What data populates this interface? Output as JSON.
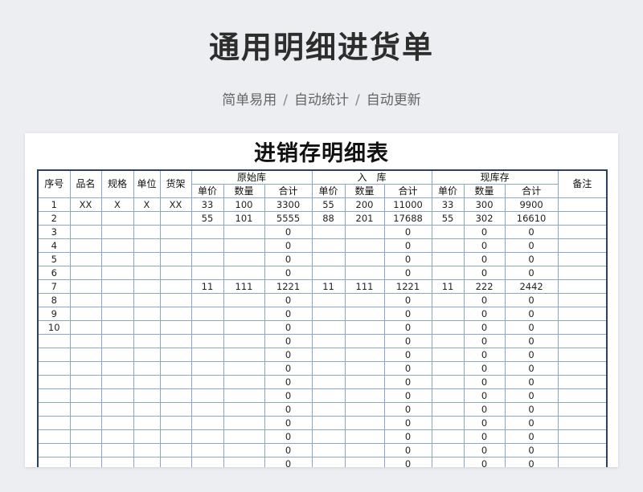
{
  "page": {
    "title": "通用明细进货单",
    "subtitle_parts": [
      "简单易用",
      "自动统计",
      "自动更新"
    ],
    "separator": "/"
  },
  "sheet": {
    "title": "进销存明细表",
    "headers": {
      "seq": "序号",
      "name": "品名",
      "spec": "规格",
      "unit": "单位",
      "shelf": "货架",
      "group_original": "原始库",
      "group_in": "入　库",
      "group_stock": "现库存",
      "remark": "备注",
      "unit_price": "单价",
      "quantity": "数量",
      "total": "合计"
    },
    "rows": [
      {
        "seq": "1",
        "name": "XX",
        "spec": "X",
        "unit": "X",
        "shelf": "XX",
        "o_price": "33",
        "o_qty": "100",
        "o_total": "3300",
        "i_price": "55",
        "i_qty": "200",
        "i_total": "11000",
        "s_price": "33",
        "s_qty": "300",
        "s_total": "9900",
        "remark": ""
      },
      {
        "seq": "2",
        "name": "",
        "spec": "",
        "unit": "",
        "shelf": "",
        "o_price": "55",
        "o_qty": "101",
        "o_total": "5555",
        "i_price": "88",
        "i_qty": "201",
        "i_total": "17688",
        "s_price": "55",
        "s_qty": "302",
        "s_total": "16610",
        "remark": ""
      },
      {
        "seq": "3",
        "name": "",
        "spec": "",
        "unit": "",
        "shelf": "",
        "o_price": "",
        "o_qty": "",
        "o_total": "0",
        "i_price": "",
        "i_qty": "",
        "i_total": "0",
        "s_price": "",
        "s_qty": "0",
        "s_total": "0",
        "remark": ""
      },
      {
        "seq": "4",
        "name": "",
        "spec": "",
        "unit": "",
        "shelf": "",
        "o_price": "",
        "o_qty": "",
        "o_total": "0",
        "i_price": "",
        "i_qty": "",
        "i_total": "0",
        "s_price": "",
        "s_qty": "0",
        "s_total": "0",
        "remark": ""
      },
      {
        "seq": "5",
        "name": "",
        "spec": "",
        "unit": "",
        "shelf": "",
        "o_price": "",
        "o_qty": "",
        "o_total": "0",
        "i_price": "",
        "i_qty": "",
        "i_total": "0",
        "s_price": "",
        "s_qty": "0",
        "s_total": "0",
        "remark": ""
      },
      {
        "seq": "6",
        "name": "",
        "spec": "",
        "unit": "",
        "shelf": "",
        "o_price": "",
        "o_qty": "",
        "o_total": "0",
        "i_price": "",
        "i_qty": "",
        "i_total": "0",
        "s_price": "",
        "s_qty": "0",
        "s_total": "0",
        "remark": ""
      },
      {
        "seq": "7",
        "name": "",
        "spec": "",
        "unit": "",
        "shelf": "",
        "o_price": "11",
        "o_qty": "111",
        "o_total": "1221",
        "i_price": "11",
        "i_qty": "111",
        "i_total": "1221",
        "s_price": "11",
        "s_qty": "222",
        "s_total": "2442",
        "remark": ""
      },
      {
        "seq": "8",
        "name": "",
        "spec": "",
        "unit": "",
        "shelf": "",
        "o_price": "",
        "o_qty": "",
        "o_total": "0",
        "i_price": "",
        "i_qty": "",
        "i_total": "0",
        "s_price": "",
        "s_qty": "0",
        "s_total": "0",
        "remark": ""
      },
      {
        "seq": "9",
        "name": "",
        "spec": "",
        "unit": "",
        "shelf": "",
        "o_price": "",
        "o_qty": "",
        "o_total": "0",
        "i_price": "",
        "i_qty": "",
        "i_total": "0",
        "s_price": "",
        "s_qty": "0",
        "s_total": "0",
        "remark": ""
      },
      {
        "seq": "10",
        "name": "",
        "spec": "",
        "unit": "",
        "shelf": "",
        "o_price": "",
        "o_qty": "",
        "o_total": "0",
        "i_price": "",
        "i_qty": "",
        "i_total": "0",
        "s_price": "",
        "s_qty": "0",
        "s_total": "0",
        "remark": ""
      },
      {
        "seq": "",
        "name": "",
        "spec": "",
        "unit": "",
        "shelf": "",
        "o_price": "",
        "o_qty": "",
        "o_total": "0",
        "i_price": "",
        "i_qty": "",
        "i_total": "0",
        "s_price": "",
        "s_qty": "0",
        "s_total": "0",
        "remark": ""
      },
      {
        "seq": "",
        "name": "",
        "spec": "",
        "unit": "",
        "shelf": "",
        "o_price": "",
        "o_qty": "",
        "o_total": "0",
        "i_price": "",
        "i_qty": "",
        "i_total": "0",
        "s_price": "",
        "s_qty": "0",
        "s_total": "0",
        "remark": ""
      },
      {
        "seq": "",
        "name": "",
        "spec": "",
        "unit": "",
        "shelf": "",
        "o_price": "",
        "o_qty": "",
        "o_total": "0",
        "i_price": "",
        "i_qty": "",
        "i_total": "0",
        "s_price": "",
        "s_qty": "0",
        "s_total": "0",
        "remark": ""
      },
      {
        "seq": "",
        "name": "",
        "spec": "",
        "unit": "",
        "shelf": "",
        "o_price": "",
        "o_qty": "",
        "o_total": "0",
        "i_price": "",
        "i_qty": "",
        "i_total": "0",
        "s_price": "",
        "s_qty": "0",
        "s_total": "0",
        "remark": ""
      },
      {
        "seq": "",
        "name": "",
        "spec": "",
        "unit": "",
        "shelf": "",
        "o_price": "",
        "o_qty": "",
        "o_total": "0",
        "i_price": "",
        "i_qty": "",
        "i_total": "0",
        "s_price": "",
        "s_qty": "0",
        "s_total": "0",
        "remark": ""
      },
      {
        "seq": "",
        "name": "",
        "spec": "",
        "unit": "",
        "shelf": "",
        "o_price": "",
        "o_qty": "",
        "o_total": "0",
        "i_price": "",
        "i_qty": "",
        "i_total": "0",
        "s_price": "",
        "s_qty": "0",
        "s_total": "0",
        "remark": ""
      },
      {
        "seq": "",
        "name": "",
        "spec": "",
        "unit": "",
        "shelf": "",
        "o_price": "",
        "o_qty": "",
        "o_total": "0",
        "i_price": "",
        "i_qty": "",
        "i_total": "0",
        "s_price": "",
        "s_qty": "0",
        "s_total": "0",
        "remark": ""
      },
      {
        "seq": "",
        "name": "",
        "spec": "",
        "unit": "",
        "shelf": "",
        "o_price": "",
        "o_qty": "",
        "o_total": "0",
        "i_price": "",
        "i_qty": "",
        "i_total": "0",
        "s_price": "",
        "s_qty": "0",
        "s_total": "0",
        "remark": ""
      },
      {
        "seq": "",
        "name": "",
        "spec": "",
        "unit": "",
        "shelf": "",
        "o_price": "",
        "o_qty": "",
        "o_total": "0",
        "i_price": "",
        "i_qty": "",
        "i_total": "0",
        "s_price": "",
        "s_qty": "0",
        "s_total": "0",
        "remark": ""
      },
      {
        "seq": "",
        "name": "",
        "spec": "",
        "unit": "",
        "shelf": "",
        "o_price": "",
        "o_qty": "",
        "o_total": "0",
        "i_price": "",
        "i_qty": "",
        "i_total": "0",
        "s_price": "",
        "s_qty": "0",
        "s_total": "0",
        "remark": ""
      }
    ]
  }
}
